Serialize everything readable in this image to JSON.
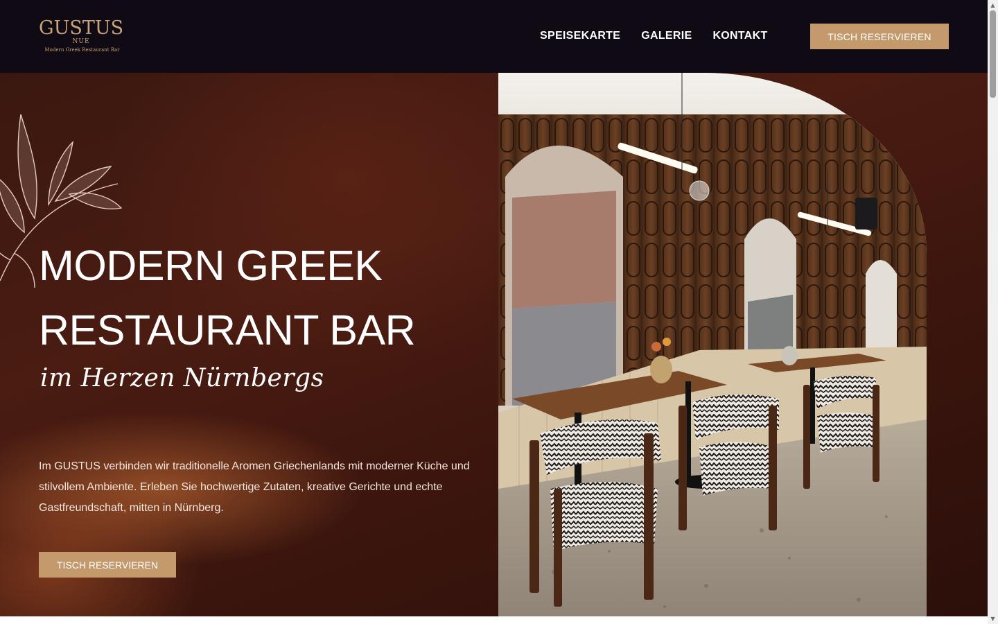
{
  "brand": {
    "name": "GUSTUS",
    "sub": "NUE",
    "tagline": "Modern Greek Restaurant Bar",
    "accent_color": "#c49a6c",
    "header_bg": "#100a14"
  },
  "nav": {
    "items": [
      "SPEISEKARTE",
      "GALERIE",
      "KONTAKT"
    ],
    "cta_label": "TISCH RESERVIEREN"
  },
  "hero": {
    "title_line1": "MODERN GREEK",
    "title_line2": "RESTAURANT BAR",
    "script": "im Herzen Nürnbergs",
    "text": "Im GUSTUS verbinden wir traditionelle Aromen Griechenlands mit moderner Küche und stilvollem Ambiente. Erleben Sie hochwertige Zutaten, kreative Gerichte und echte Gastfreundschaft, mitten in Nürnberg.",
    "cta_label": "TISCH RESERVIEREN"
  },
  "icons": {
    "leaf": "leaf-branch-icon",
    "scroll_up": "scroll-up-arrow-icon",
    "scroll_down": "scroll-down-arrow-icon"
  }
}
